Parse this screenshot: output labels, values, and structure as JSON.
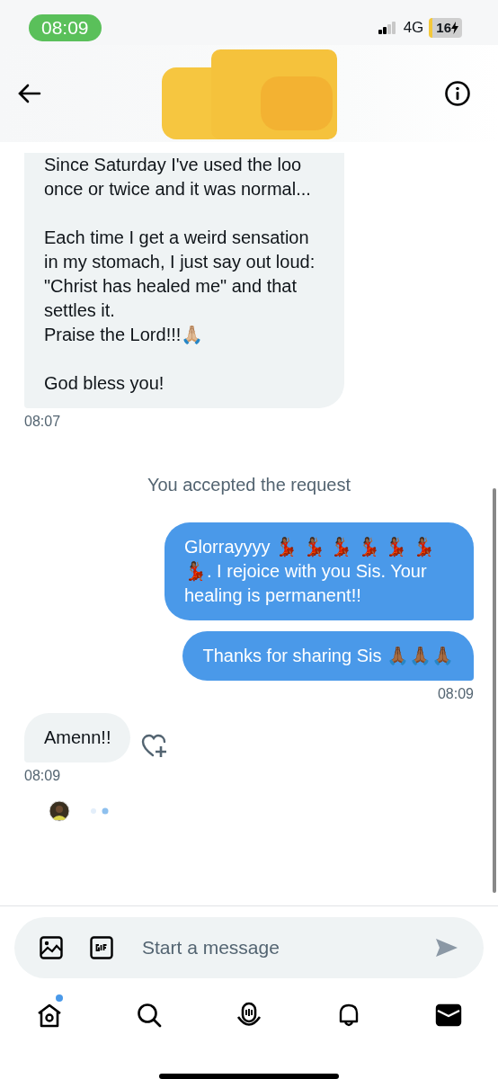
{
  "status_bar": {
    "time": "08:09",
    "network": "4G",
    "battery": "16"
  },
  "messages": [
    {
      "kind": "incoming",
      "text": "Since Saturday I've used the loo once or twice and it was normal...\n\nEach time I get a weird sensation in my stomach, I just say out loud: \"Christ has healed me\" and that settles it.\nPraise the Lord!!!🙏🏼\n\nGod bless you!",
      "time": "08:07"
    },
    {
      "kind": "system",
      "text": "You accepted the request"
    },
    {
      "kind": "outgoing",
      "text": "Glorrayyyy 💃🏾 💃🏾 💃🏾 💃🏾 💃🏾 💃🏾 💃🏾. I rejoice with you Sis. Your healing is permanent!!"
    },
    {
      "kind": "outgoing",
      "text": "Thanks for sharing Sis 🙏🏾🙏🏾🙏🏾",
      "time": "08:09"
    },
    {
      "kind": "incoming",
      "text": "Amenn!!",
      "time": "08:09",
      "react": true
    }
  ],
  "composer": {
    "placeholder": "Start a message"
  },
  "nav": [
    {
      "kind": "home",
      "selected": false,
      "badge": true
    },
    {
      "kind": "search",
      "selected": false,
      "badge": false
    },
    {
      "kind": "spaces",
      "selected": false,
      "badge": false
    },
    {
      "kind": "bell",
      "selected": false,
      "badge": false
    },
    {
      "kind": "mail",
      "selected": true,
      "badge": false
    }
  ]
}
